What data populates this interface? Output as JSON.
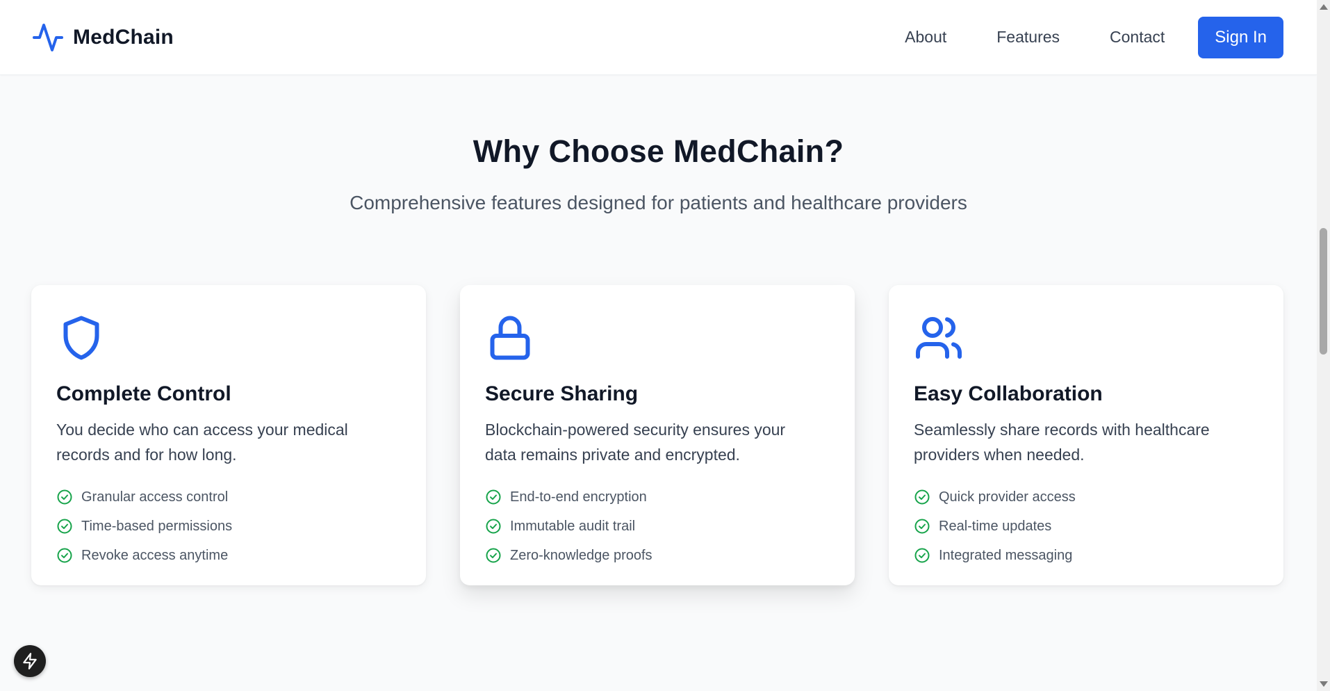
{
  "header": {
    "brand": "MedChain",
    "nav": [
      {
        "label": "About"
      },
      {
        "label": "Features"
      },
      {
        "label": "Contact"
      }
    ],
    "signin_label": "Sign In"
  },
  "section": {
    "title": "Why Choose MedChain?",
    "subtitle": "Comprehensive features designed for patients and healthcare providers"
  },
  "cards": [
    {
      "icon": "shield-icon",
      "title": "Complete Control",
      "description": "You decide who can access your medical records and for how long.",
      "features": [
        "Granular access control",
        "Time-based permissions",
        "Revoke access anytime"
      ]
    },
    {
      "icon": "lock-icon",
      "title": "Secure Sharing",
      "description": "Blockchain-powered security ensures your data remains private and encrypted.",
      "features": [
        "End-to-end encryption",
        "Immutable audit trail",
        "Zero-knowledge proofs"
      ]
    },
    {
      "icon": "users-icon",
      "title": "Easy Collaboration",
      "description": "Seamlessly share records with healthcare providers when needed.",
      "features": [
        "Quick provider access",
        "Real-time updates",
        "Integrated messaging"
      ]
    }
  ],
  "colors": {
    "accent": "#2563eb",
    "check": "#16a34a",
    "heading": "#111827",
    "body_text": "#374151"
  }
}
